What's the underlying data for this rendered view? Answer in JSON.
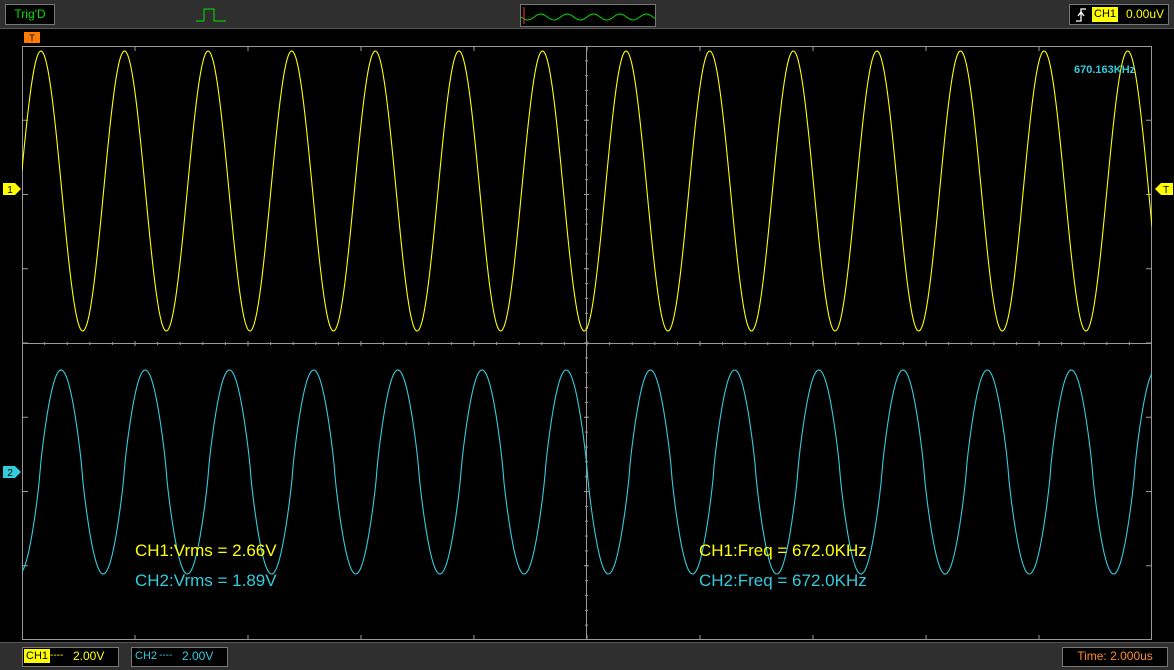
{
  "topbar": {
    "trigger_status": "Trig'D",
    "trigger_source": "CH1",
    "trigger_level": "0.00uV"
  },
  "markers": {
    "time_position": "T",
    "ch1": "1",
    "ch2": "2",
    "trigger_level": "T"
  },
  "frequency_readout": "670.163KHz",
  "measurements": {
    "ch1_vrms": "CH1:Vrms = 2.66V",
    "ch2_vrms": "CH2:Vrms = 1.89V",
    "ch1_freq": "CH1:Freq = 672.0KHz",
    "ch2_freq": "CH2:Freq = 672.0KHz"
  },
  "bottombar": {
    "ch1_label": "CH1",
    "ch1_coupling": "----",
    "ch1_scale": "2.00V",
    "ch2_label": "CH2",
    "ch2_coupling": "----",
    "ch2_scale": "2.00V",
    "timebase": "Time: 2.000us"
  },
  "colors": {
    "ch1": "#ffff00",
    "ch2": "#33ccdd",
    "timebase": "#ff8a2a",
    "status_ok": "#00e000",
    "marker_orange": "#ff7a00"
  }
}
